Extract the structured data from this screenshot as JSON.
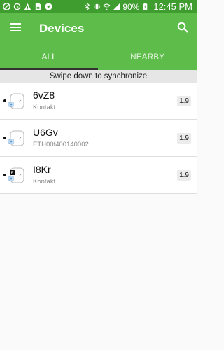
{
  "statusbar": {
    "battery_text": "90%",
    "time": "12:45 PM",
    "left_icons": [
      "no-entry-icon",
      "sync-icon",
      "warning-icon",
      "file-icon",
      "navigation-icon"
    ],
    "right_icons": [
      "bluetooth-icon",
      "vibrate-icon",
      "wifi-icon",
      "signal-icon",
      "battery-icon"
    ]
  },
  "appbar": {
    "title": "Devices",
    "menu_icon": "menu-icon",
    "search_icon": "search-icon"
  },
  "tabs": [
    {
      "label": "ALL",
      "active": true
    },
    {
      "label": "NEARBY",
      "active": false
    }
  ],
  "hint": "Swipe down to synchronize",
  "devices": [
    {
      "name": "6vZ8",
      "subtitle": "Kontakt",
      "version": "1.9",
      "icon": "beacon-icon"
    },
    {
      "name": "U6Gv",
      "subtitle": "ETH00f400140002",
      "version": "1.9",
      "icon": "beacon-icon"
    },
    {
      "name": "I8Kr",
      "subtitle": "Kontakt",
      "version": "1.9",
      "icon": "beacon-e-icon"
    }
  ],
  "colors": {
    "status_bar": "#3f9d2f",
    "app_bar": "#5ebd4a",
    "tab_indicator": "#333333",
    "hint_bg": "#e6e6e6"
  }
}
